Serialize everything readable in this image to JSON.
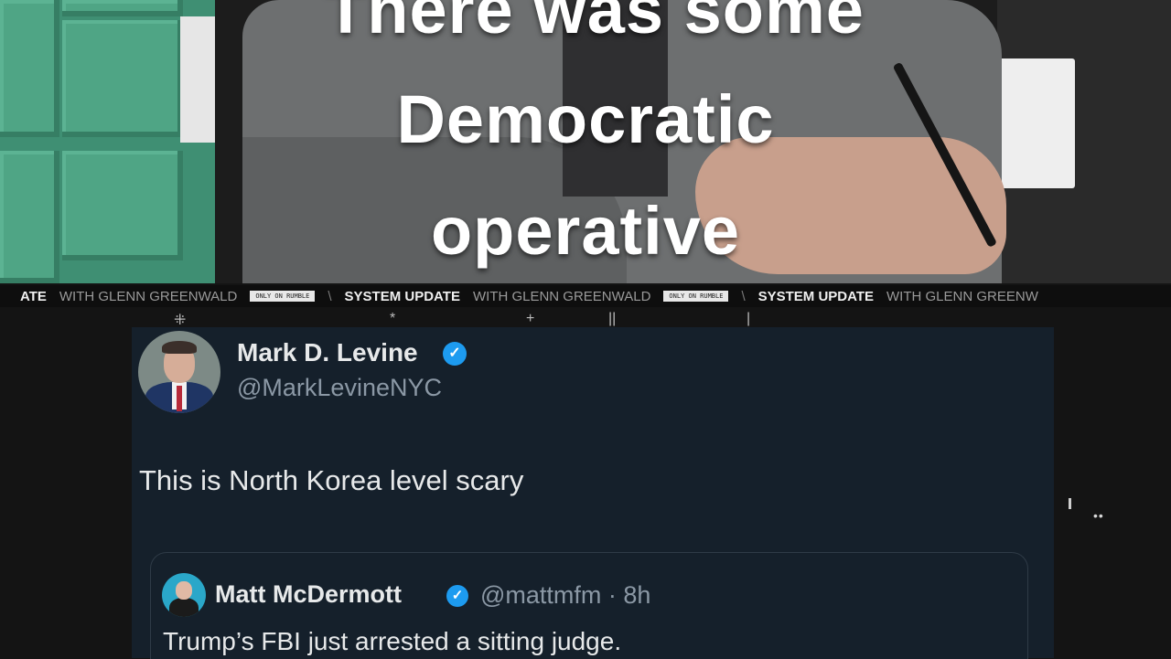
{
  "video": {
    "caption_lines": [
      "There was some",
      "Democratic",
      "operative"
    ]
  },
  "ticker": {
    "items": [
      {
        "bold": "ATE",
        "light": "WITH GLENN GREENWALD",
        "badge": "ONLY ON RUMBLE"
      },
      {
        "bold": "SYSTEM UPDATE",
        "light": "WITH GLENN GREENWALD",
        "badge": "ONLY ON RUMBLE"
      },
      {
        "bold": "SYSTEM UPDATE",
        "light": "WITH GLENN GREENW",
        "badge": ""
      }
    ],
    "separator": "\\",
    "glyphs": [
      "⁜",
      "*",
      "+",
      "||",
      "|"
    ]
  },
  "tweet": {
    "author_name": "Mark D. Levine",
    "author_handle": "@MarkLevineNYC",
    "verified_glyph": "✓",
    "text": "This is North Korea level scary",
    "quote": {
      "author_name": "Matt McDermott",
      "author_handle": "@mattmfm · 8h",
      "text": "Trump’s FBI just arrested a sitting judge."
    },
    "more_glyph": "••"
  },
  "colors": {
    "tweet_bg": "#15202b",
    "verified": "#1d9bf0",
    "handle_gray": "#8b98a5",
    "wall_green": "#3f8f73"
  }
}
